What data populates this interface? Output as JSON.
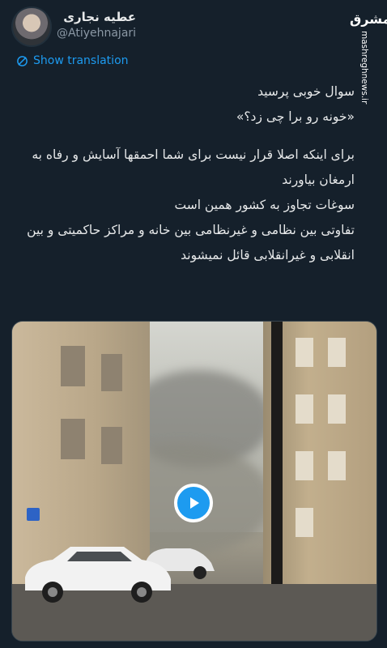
{
  "author": {
    "display_name": "عطیه نجاری",
    "handle": "@Atiyehnajari"
  },
  "watermark": {
    "logo": "مشرق",
    "site": "mashreghnews.ir"
  },
  "translate": {
    "label": "Show translation"
  },
  "tweet": {
    "lines": [
      "سوال خوبی پرسید",
      "«خونه رو برا چی زد؟»",
      "برای اینکه اصلا قرار نیست برای شما احمقها آسایش و رفاه به ارمغان بیاورند",
      "سوغات تجاوز به کشور همین است",
      "تفاوتی بین نظامی و غیرنظامی بین خانه و مراکز حاکمیتی و بین انقلابی و غیرانقلابی قائل نمیشوند"
    ]
  },
  "media": {
    "type": "video",
    "play_icon": "play-icon"
  },
  "colors": {
    "background": "#15202b",
    "text": "#e7e9ea",
    "muted": "#8b98a5",
    "accent": "#1d9bf0"
  }
}
